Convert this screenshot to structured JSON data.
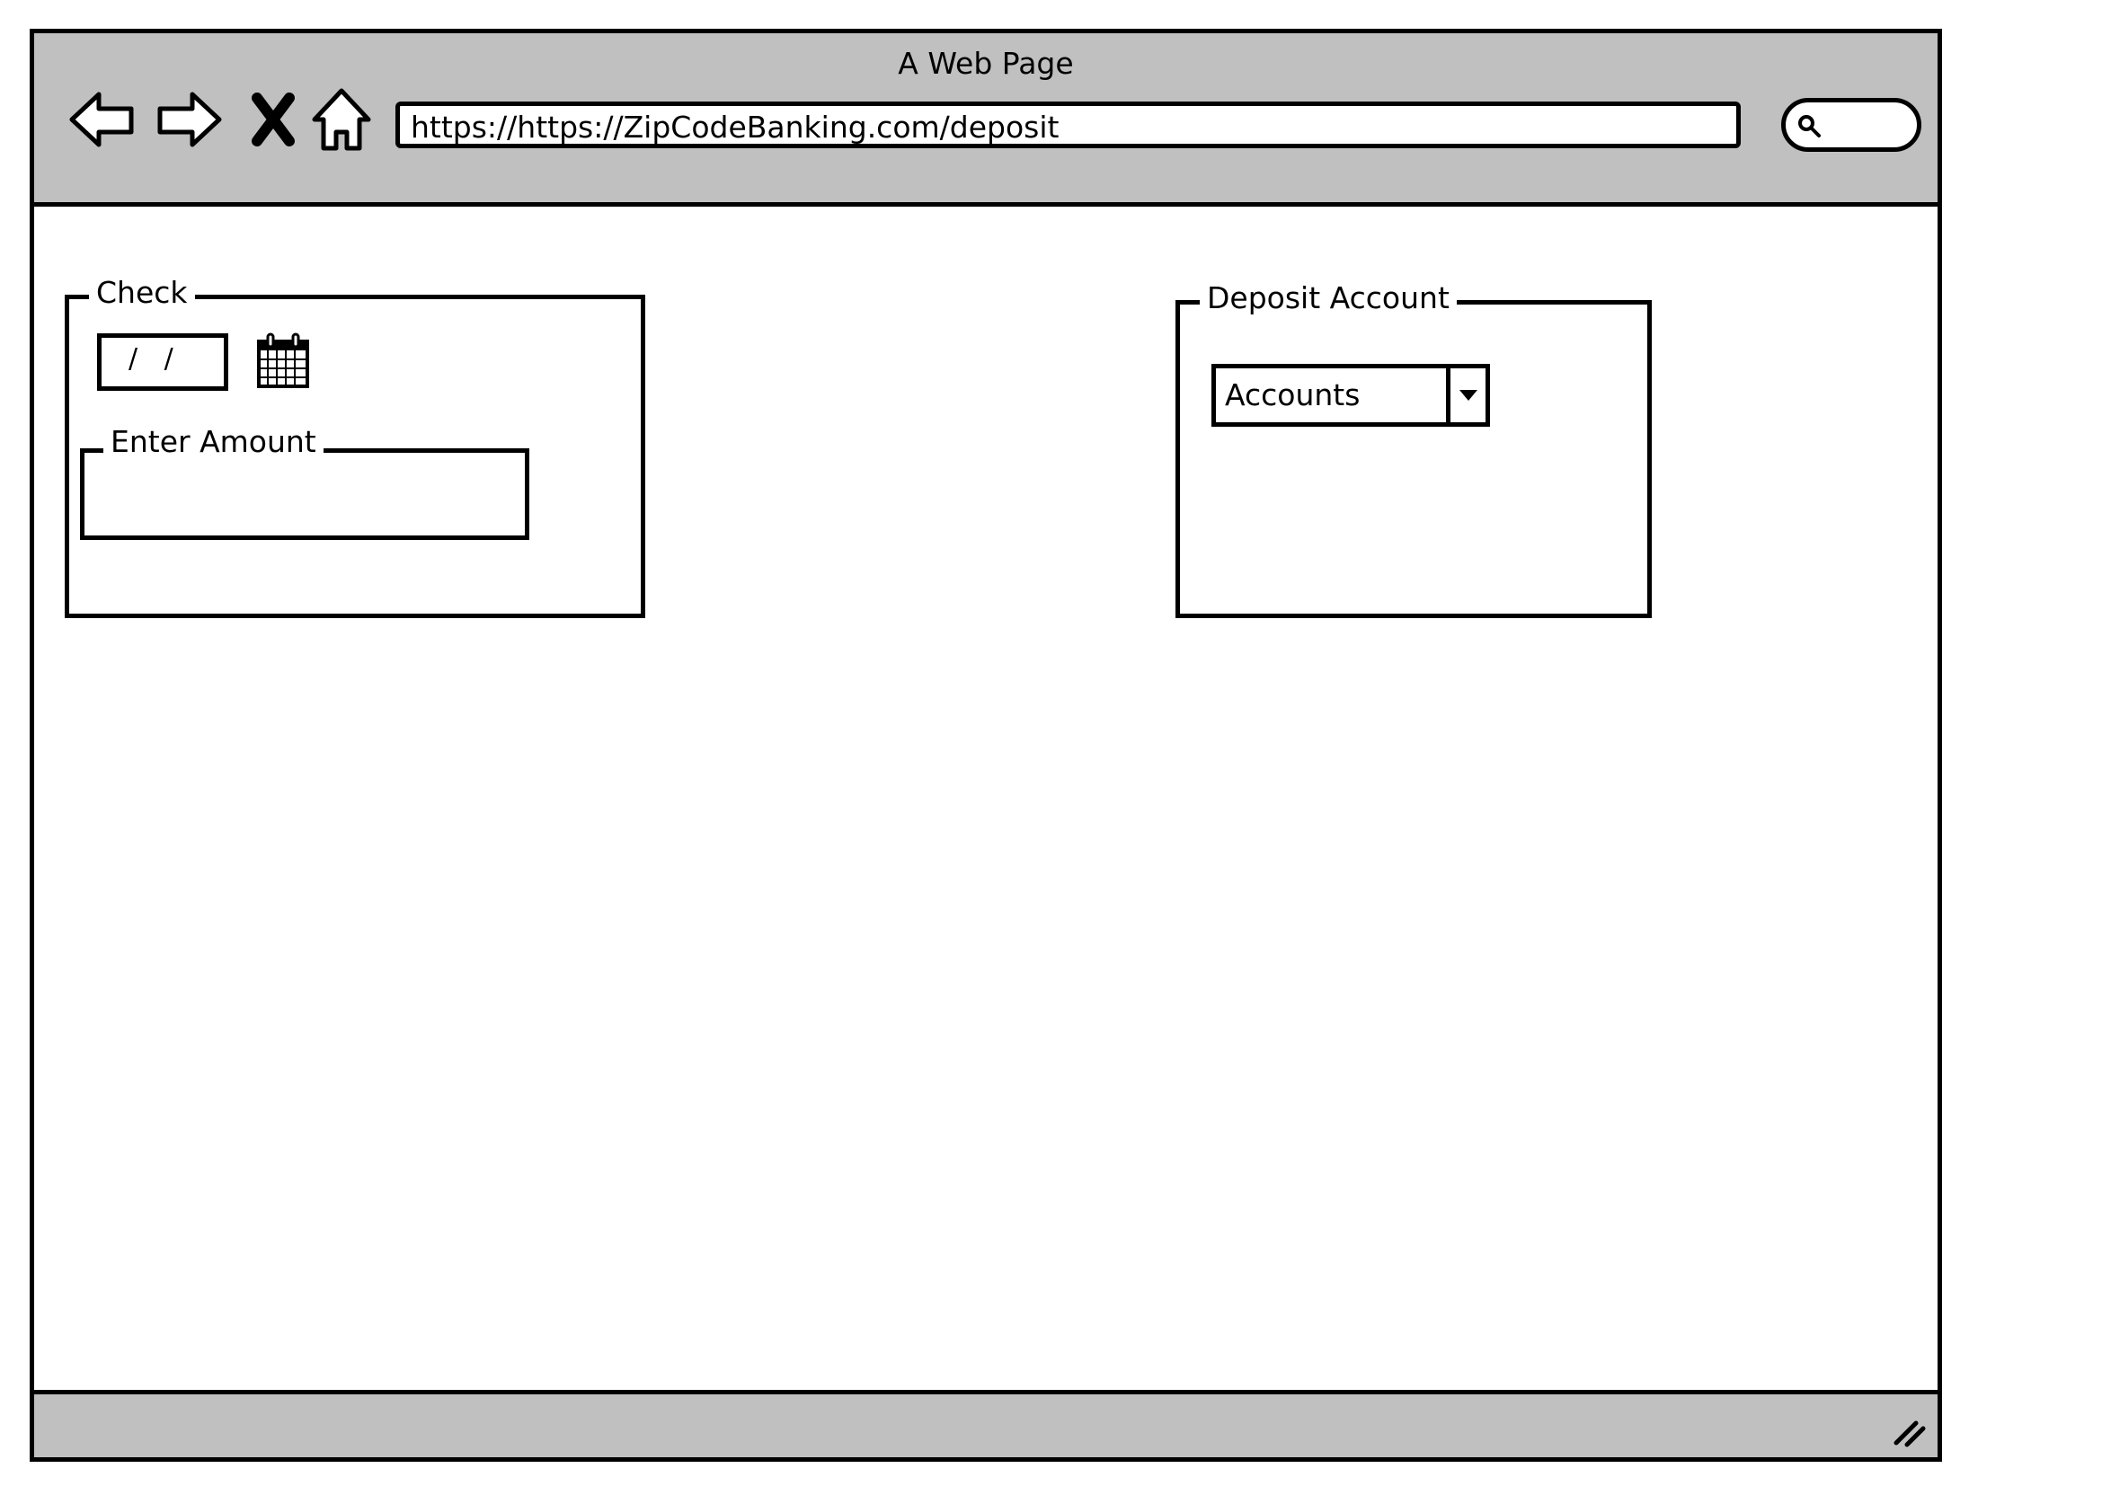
{
  "window": {
    "title": "A Web Page",
    "url": "https://https://ZipCodeBanking.com/deposit"
  },
  "nav": {
    "icons": [
      "back-arrow-icon",
      "forward-arrow-icon",
      "close-icon",
      "home-icon"
    ]
  },
  "check_group": {
    "label": "Check",
    "date_value": "/ /",
    "amount_label": "Enter Amount",
    "amount_value": ""
  },
  "deposit_group": {
    "label": "Deposit Account",
    "selected_account": "Accounts"
  },
  "colors": {
    "chrome": "#c0c0c0",
    "background": "#ffffff",
    "ink": "#000000"
  }
}
